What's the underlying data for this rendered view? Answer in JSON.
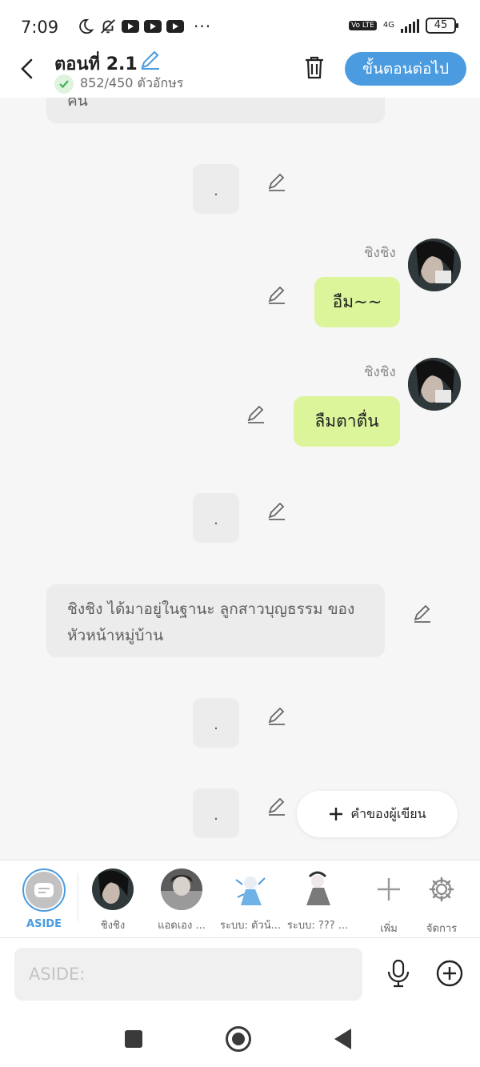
{
  "status_bar": {
    "time": "7:09",
    "battery": "45",
    "network": "4G",
    "volte": "Vo LTE",
    "more": "···"
  },
  "header": {
    "title": "ตอนที่ 2.1",
    "char_count": "852/450 ตัวอักษร",
    "next_button": "ขั้นตอนต่อไป"
  },
  "chat": {
    "top_narration_partial": "คน",
    "messages": [
      {
        "type": "narration",
        "text": "."
      },
      {
        "type": "dialogue",
        "speaker": "ชิงชิง",
        "text": "อืม~~"
      },
      {
        "type": "dialogue",
        "speaker": "ชิงชิง",
        "text": "ลืมตาตื่น"
      },
      {
        "type": "narration",
        "text": "."
      },
      {
        "type": "narration",
        "text": "ชิงชิง ได้มาอยู่ในฐานะ ลูกสาวบุญธรรม ของหัวหน้าหมู่บ้าน"
      },
      {
        "type": "narration",
        "text": "."
      },
      {
        "type": "narration",
        "text": "."
      }
    ],
    "author_note_button": "คำของผู้เขียน"
  },
  "character_bar": {
    "items": [
      {
        "label": "ASIDE",
        "color": "#4a9be0"
      },
      {
        "label": "ชิงชิง"
      },
      {
        "label": "แอดเอง ..."
      },
      {
        "label": "ระบบ: ตัวน้..."
      },
      {
        "label": "ระบบ: ??? ..."
      }
    ],
    "add_label": "เพิ่ม",
    "manage_label": "จัดการ"
  },
  "input": {
    "placeholder": "ASIDE:"
  },
  "colors": {
    "accent": "#4a9be0",
    "bubble": "#dcf59a",
    "narration_bg": "#ececec"
  }
}
